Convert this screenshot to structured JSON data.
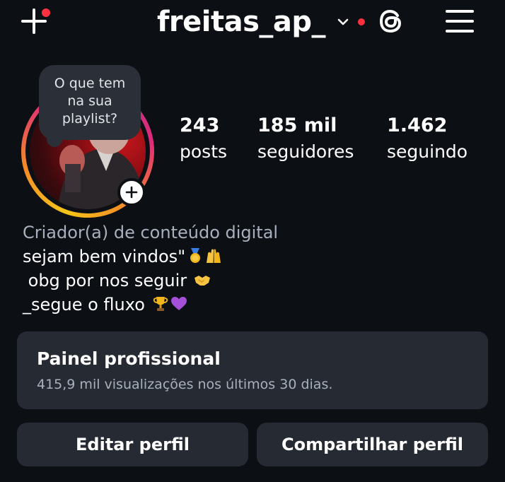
{
  "header": {
    "username": "freitas_ap_",
    "icons": {
      "create": "plus-icon",
      "switch_account": "chevron-down-icon",
      "threads": "threads-icon",
      "menu": "menu-icon"
    },
    "notification_color": "#ff3040"
  },
  "profile": {
    "avatar_icon": "profile-photo",
    "add_story_icon": "plus-icon",
    "note": {
      "text": "O que tem na sua playlist?"
    },
    "ring_colors": [
      "#f5c518",
      "#f58529",
      "#dd2a7b",
      "#c13584"
    ]
  },
  "stats": {
    "posts": {
      "value": "243",
      "label": "posts"
    },
    "followers": {
      "value": "185 mil",
      "label": "seguidores"
    },
    "following": {
      "value": "1.462",
      "label": "seguindo"
    }
  },
  "bio": {
    "category": "Criador(a) de conteúdo digital",
    "lines": [
      {
        "text": "sejam bem vindos\"",
        "emojis": [
          "medal-emoji",
          "raised-hands-emoji"
        ]
      },
      {
        "text": " obg por nos seguir ",
        "emojis": [
          "handshake-emoji"
        ]
      },
      {
        "text": "_segue o fluxo ",
        "emojis": [
          "trophy-emoji",
          "purple-heart-emoji"
        ]
      }
    ]
  },
  "professional_panel": {
    "title": "Painel profissional",
    "subtitle": "415,9 mil visualizações nos últimos 30 dias."
  },
  "buttons": {
    "edit_profile": "Editar perfil",
    "share_profile": "Compartilhar perfil"
  },
  "colors": {
    "background": "#0c0f14",
    "card": "#262a33",
    "secondary_text": "#a8b0bd"
  }
}
